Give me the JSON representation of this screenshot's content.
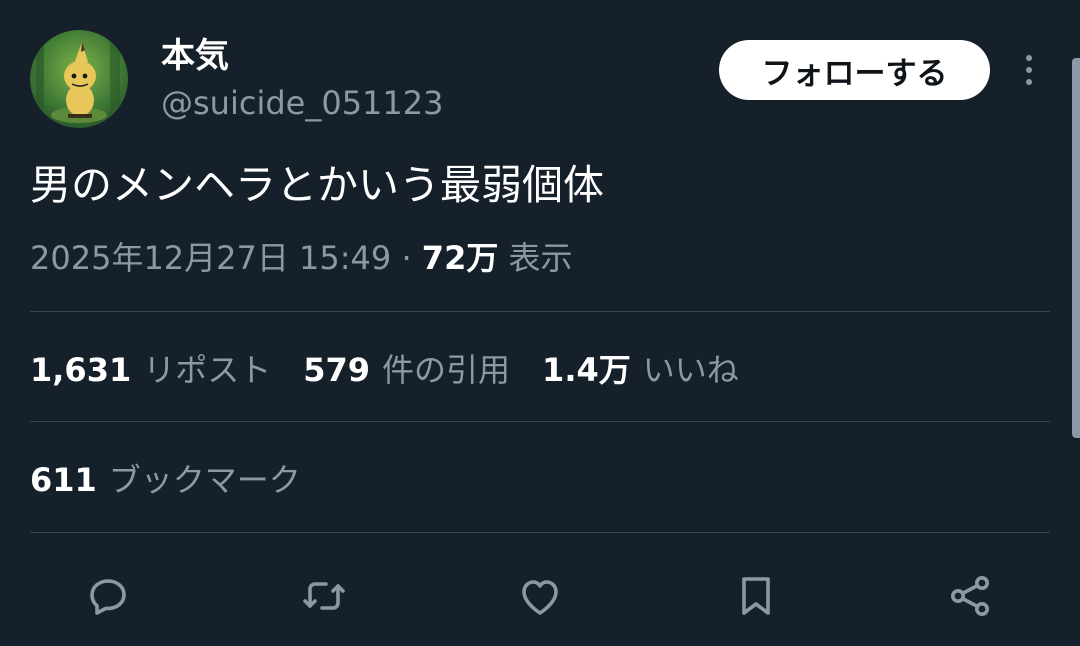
{
  "user": {
    "display_name": "本気",
    "handle": "@suicide_051123",
    "avatar_icon": "avatar-icon"
  },
  "follow_button": {
    "label": "フォローする"
  },
  "more_button": {
    "icon": "more-vertical-icon"
  },
  "tweet": {
    "text": "男のメンヘラとかいう最弱個体",
    "timestamp": "2025年12月27日 15:49",
    "separator": "·",
    "views_count": "72万",
    "views_label": "表示"
  },
  "stats": {
    "reposts": {
      "count": "1,631",
      "label": "リポスト"
    },
    "quotes": {
      "count": "579",
      "label": "件の引用"
    },
    "likes": {
      "count": "1.4万",
      "label": "いいね"
    },
    "bookmarks": {
      "count": "611",
      "label": "ブックマーク"
    }
  },
  "actions": [
    {
      "name": "reply-icon"
    },
    {
      "name": "repost-icon"
    },
    {
      "name": "like-icon"
    },
    {
      "name": "bookmark-icon"
    },
    {
      "name": "share-icon"
    }
  ],
  "colors": {
    "background": "#15202b",
    "text_primary": "#ffffff",
    "text_secondary": "#8b98a5",
    "divider": "#38444d",
    "button_bg": "#ffffff"
  }
}
